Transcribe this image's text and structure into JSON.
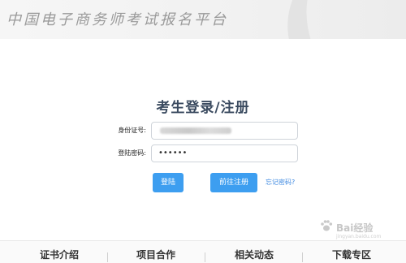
{
  "header": {
    "site_title": "中国电子商务师考试报名平台"
  },
  "login": {
    "title": "考生登录/注册",
    "id_label": "身份证号:",
    "password_label": "登陆密码:",
    "password_value": "••••••",
    "login_button": "登陆",
    "register_button": "前往注册",
    "forgot_link": "忘记密码?"
  },
  "footer": {
    "items": [
      "证书介绍",
      "项目合作",
      "相关动态",
      "下载专区"
    ]
  },
  "watermark": {
    "text": "Bai经验",
    "url": "jingyan.baidu.com"
  },
  "colors": {
    "primary_button": "#3d9ef0",
    "link": "#3d88e0",
    "title": "#3a4a5f"
  }
}
